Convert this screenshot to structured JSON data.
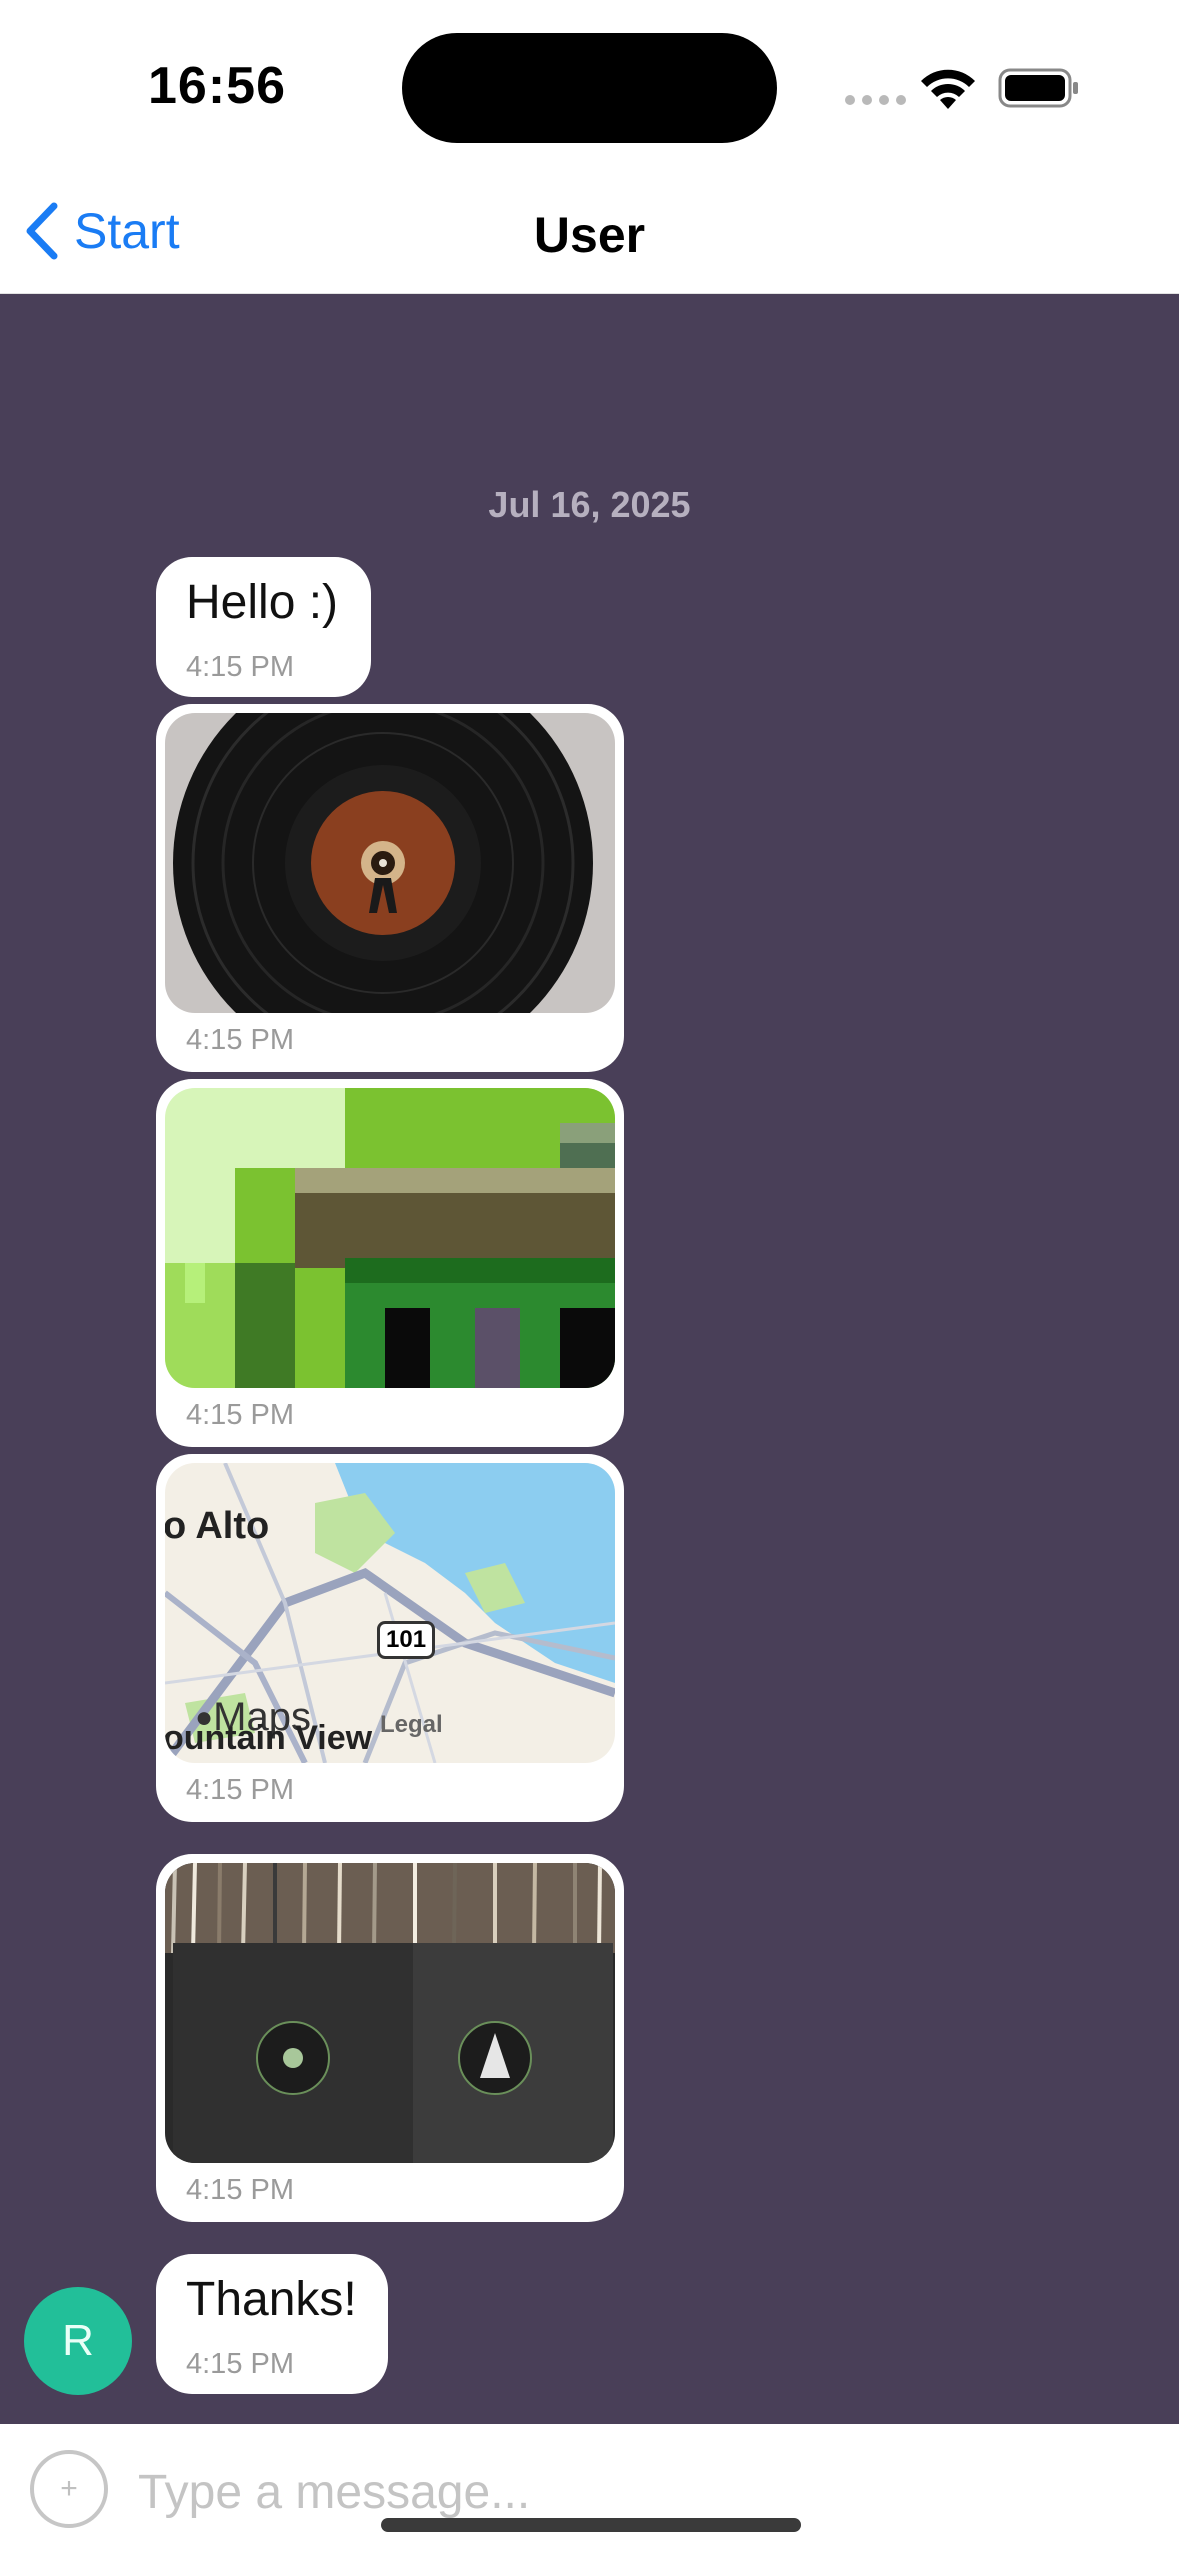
{
  "status_bar": {
    "time": "16:56",
    "wifi_icon": "wifi-icon",
    "battery_icon": "battery-icon"
  },
  "nav": {
    "back_label": "Start",
    "title": "User"
  },
  "chat": {
    "date_separator": "Jul 16, 2025",
    "messages": [
      {
        "type": "text",
        "text": "Hello :)",
        "time": "4:15 PM"
      },
      {
        "type": "image",
        "image": "vinyl-record-photo",
        "time": "4:15 PM"
      },
      {
        "type": "image",
        "image": "pixelated-green-image",
        "time": "4:15 PM"
      },
      {
        "type": "location",
        "image": "map-snapshot",
        "map_labels": [
          "o Alto",
          "101",
          "Maps",
          "Legal",
          "ountain View"
        ],
        "time": "4:15 PM"
      },
      {
        "type": "image",
        "image": "record-sleeves-photo",
        "time": "4:15 PM"
      },
      {
        "type": "text",
        "text": "Thanks!",
        "time": "4:15 PM",
        "avatar_initial": "R"
      }
    ]
  },
  "composer": {
    "placeholder": "Type a message...",
    "value": ""
  },
  "colors": {
    "chat_background": "#493f58",
    "accent": "#1a7cf4",
    "avatar": "#22bf99",
    "bubble": "#ffffff"
  }
}
